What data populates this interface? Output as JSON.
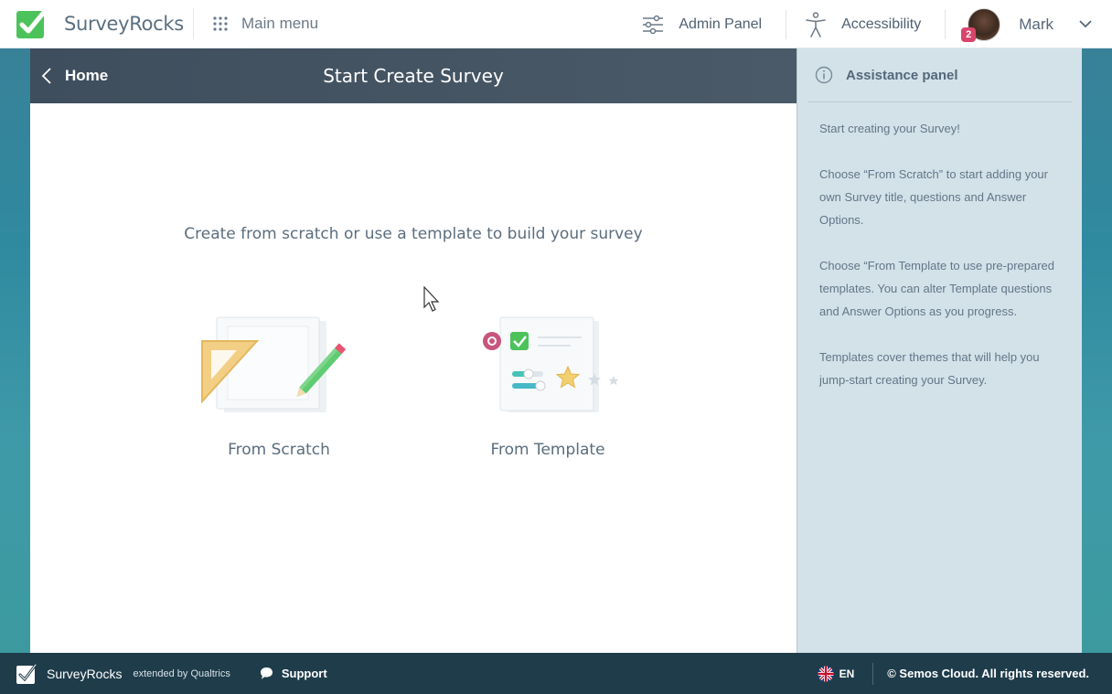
{
  "header": {
    "brand_name": "SurveyRocks",
    "main_menu_label": "Main menu",
    "admin_panel_label": "Admin Panel",
    "accessibility_label": "Accessibility",
    "user_name": "Mark",
    "notification_count": "2"
  },
  "main": {
    "back_label": "Home",
    "title": "Start Create Survey",
    "subtitle": "Create from scratch or use a template to build your survey",
    "options": [
      {
        "label": "From Scratch",
        "icon": "ruler-pencil-icon"
      },
      {
        "label": "From Template",
        "icon": "template-checklist-icon"
      }
    ]
  },
  "assistance": {
    "title": "Assistance panel",
    "paragraphs": [
      "Start creating your Survey!",
      "Choose “From Scratch” to start adding your own Survey title, questions and Answer Options.",
      "Choose “From Template to use pre-prepared templates. You can alter Template questions and Answer Options as you progress.",
      "Templates cover themes that will help you jump-start creating your Survey."
    ]
  },
  "footer": {
    "brand_name": "SurveyRocks",
    "extended": "extended by Qualtrics",
    "support_label": "Support",
    "language": "EN",
    "copyright": "© Semos Cloud. All rights reserved."
  },
  "colors": {
    "brand_green": "#4cc35a",
    "header_dark": "#3e4e5d",
    "footer_dark": "#1f3c4b",
    "assist_bg": "#d3e2e9",
    "badge": "#d9456a"
  }
}
